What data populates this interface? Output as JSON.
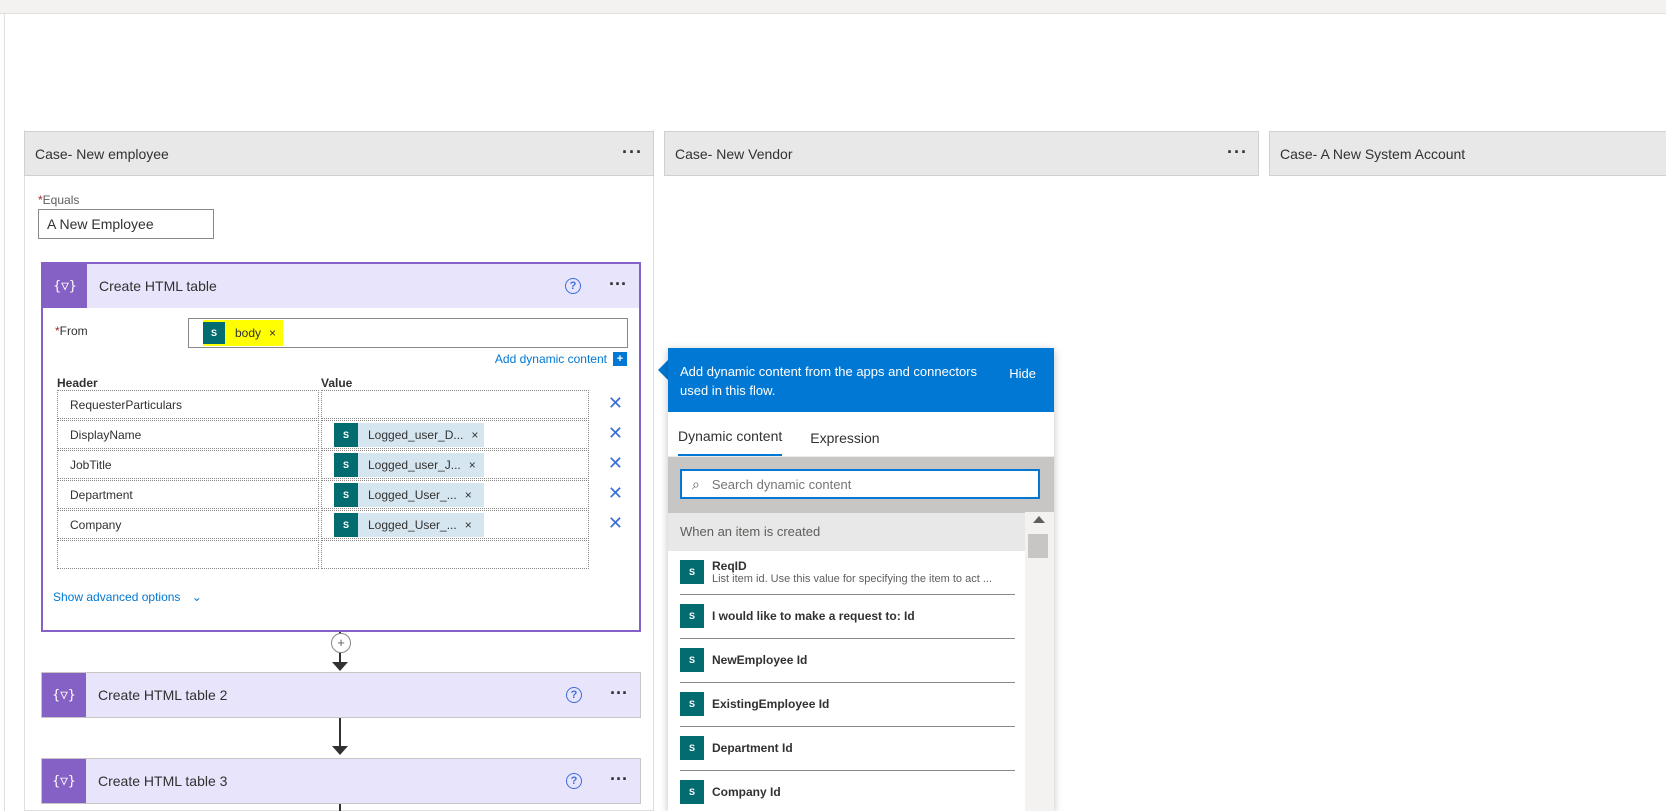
{
  "cases": [
    {
      "title": "Case- New employee"
    },
    {
      "title": "Case- New Vendor"
    },
    {
      "title": "Case- A New System Account"
    }
  ],
  "equals": {
    "label": "Equals",
    "required": "*",
    "value": "A New Employee"
  },
  "action1": {
    "title": "Create HTML table",
    "from_label": "From",
    "from_token": "body",
    "token_remove": "×",
    "add_dynamic": "Add dynamic content",
    "add_dynamic_icon": "+",
    "header_col": "Header",
    "value_col": "Value",
    "rows": [
      {
        "key": "RequesterParticulars",
        "value": ""
      },
      {
        "key": "DisplayName",
        "value": "Logged_user_D..."
      },
      {
        "key": "JobTitle",
        "value": "Logged_user_J..."
      },
      {
        "key": "Department",
        "value": "Logged_User_..."
      },
      {
        "key": "Company",
        "value": "Logged_User_..."
      }
    ],
    "advanced": "Show advanced options"
  },
  "action2": {
    "title": "Create HTML table 2"
  },
  "action3": {
    "title": "Create HTML table 3"
  },
  "icons": {
    "action": "{▽}",
    "sp": "S",
    "help": "?",
    "more": "···",
    "remove_row": "✕",
    "chevron": "⌄",
    "plus": "+",
    "search": "⌕"
  },
  "panel": {
    "header": "Add dynamic content from the apps and connectors used in this flow.",
    "hide": "Hide",
    "tabs": [
      "Dynamic content",
      "Expression"
    ],
    "search_placeholder": "Search dynamic content",
    "section": "When an item is created",
    "items": [
      {
        "name": "ReqID",
        "desc": "List item id. Use this value for specifying the item to act ..."
      },
      {
        "name": "I would like to make a request to: Id",
        "desc": ""
      },
      {
        "name": "NewEmployee Id",
        "desc": ""
      },
      {
        "name": "ExistingEmployee Id",
        "desc": ""
      },
      {
        "name": "Department Id",
        "desc": ""
      },
      {
        "name": "Company Id",
        "desc": ""
      }
    ]
  },
  "colors": {
    "accent": "#0078d4",
    "action": "#8661c5",
    "highlight": "#ffff00",
    "sharepoint": "#036c70"
  }
}
